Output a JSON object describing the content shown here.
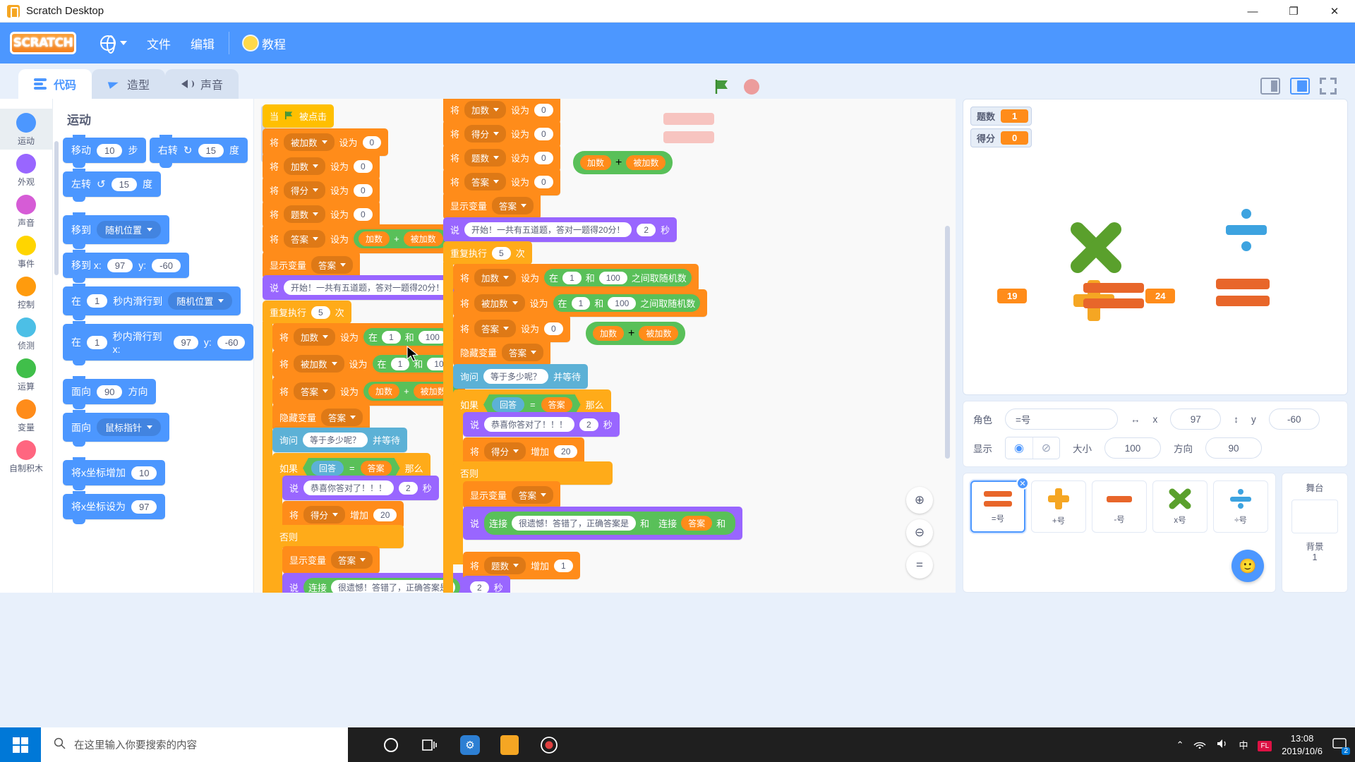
{
  "window": {
    "title": "Scratch Desktop",
    "app_icon": "scratch-app-icon",
    "minimize": "—",
    "maximize": "❐",
    "close": "✕"
  },
  "menubar": {
    "logo": "SCRATCH",
    "language_icon": "globe-icon",
    "items": [
      {
        "label": "文件",
        "name": "file"
      },
      {
        "label": "编辑",
        "name": "edit"
      },
      {
        "label": "教程",
        "name": "tutorials",
        "icon": "lightbulb-icon"
      }
    ]
  },
  "tabs": [
    {
      "label": "代码",
      "icon": "code-icon",
      "active": true
    },
    {
      "label": "造型",
      "icon": "brush-icon",
      "active": false
    },
    {
      "label": "声音",
      "icon": "sound-icon",
      "active": false
    }
  ],
  "stage_controls": {
    "green_flag": "green-flag-icon",
    "stop": "stop-icon"
  },
  "layout_controls": {
    "small_stage": "small-stage-icon",
    "large_stage": "large-stage-icon",
    "fullscreen": "fullscreen-icon"
  },
  "categories": [
    {
      "label": "运动",
      "color": "#4c97ff",
      "active": true
    },
    {
      "label": "外观",
      "color": "#9966ff",
      "active": false
    },
    {
      "label": "声音",
      "color": "#d65cd6",
      "active": false
    },
    {
      "label": "事件",
      "color": "#ffd500",
      "active": false
    },
    {
      "label": "控制",
      "color": "#ff9b0d",
      "active": false
    },
    {
      "label": "侦测",
      "color": "#4cbfe6",
      "active": false
    },
    {
      "label": "运算",
      "color": "#40bf4a",
      "active": false
    },
    {
      "label": "变量",
      "color": "#ff8c1a",
      "active": false
    },
    {
      "label": "自制积木",
      "color": "#ff6680",
      "active": false
    }
  ],
  "palette": {
    "title": "运动",
    "blocks": [
      {
        "id": "move",
        "parts": [
          "移动",
          "10",
          "步"
        ]
      },
      {
        "id": "turn-right",
        "parts": [
          "右转",
          "↻",
          "15",
          "度"
        ]
      },
      {
        "id": "turn-left",
        "parts": [
          "左转",
          "↺",
          "15",
          "度"
        ]
      },
      {
        "id": "goto",
        "parts": [
          "移到",
          "随机位置"
        ]
      },
      {
        "id": "goto-xy",
        "parts": [
          "移到 x:",
          "97",
          "y:",
          "-60"
        ]
      },
      {
        "id": "glide-to",
        "parts": [
          "在",
          "1",
          "秒内滑行到",
          "随机位置"
        ]
      },
      {
        "id": "glide-xy",
        "parts": [
          "在",
          "1",
          "秒内滑行到 x:",
          "97",
          "y:",
          "-60"
        ]
      },
      {
        "id": "point-dir",
        "parts": [
          "面向",
          "90",
          "方向"
        ]
      },
      {
        "id": "point-to",
        "parts": [
          "面向",
          "鼠标指针"
        ]
      },
      {
        "id": "change-x",
        "parts": [
          "将x坐标增加",
          "10"
        ]
      },
      {
        "id": "set-x",
        "parts": [
          "将x坐标设为",
          "97"
        ]
      }
    ],
    "labels": {
      "move": "移动",
      "steps": "步",
      "turn_right": "右转",
      "turn_left": "左转",
      "degrees": "度",
      "goto": "移到",
      "random_position": "随机位置",
      "goto_x": "移到 x:",
      "y": "y:",
      "at": "在",
      "glide_secs": "秒内滑行到",
      "glide_secs_x": "秒内滑行到 x:",
      "point_dir": "面向",
      "direction": "方向",
      "mouse_pointer": "鼠标指针",
      "change_x": "将x坐标增加",
      "set_x": "将x坐标设为"
    },
    "values": {
      "ten": "10",
      "fifteen": "15",
      "one": "1",
      "ninety": "90",
      "x97": "97",
      "yneg60": "-60"
    }
  },
  "workspace": {
    "words": {
      "when": "当",
      "clicked": "被点击",
      "set": "将",
      "to": "设为",
      "change_by": "增加",
      "show_var": "显示变量",
      "hide_var": "隐藏变量",
      "say": "说",
      "secs": "秒",
      "repeat": "重复执行",
      "times": "次",
      "pick_random_a": "在",
      "pick_random_and": "和",
      "pick_random_b": "之间取随机数",
      "ask": "询问",
      "and_wait": "并等待",
      "if": "如果",
      "then": "那么",
      "else": "否则",
      "answer": "回答",
      "equals": "=",
      "plus": "+",
      "join": "连接"
    },
    "variables": {
      "augend": "被加数",
      "addend": "加数",
      "score": "得分",
      "qcount": "题数",
      "answer_var": "答案"
    },
    "values": {
      "zero": "0",
      "one": "1",
      "hundred": "100",
      "five": "5",
      "two": "2",
      "twenty": "20"
    },
    "messages": {
      "intro": "开始！一共有五道题，答对一题得20分！",
      "question": "等于多少呢？",
      "correct": "恭喜你答对了！！！",
      "wrong": "很遗憾！答错了，正确答案是"
    },
    "zoom_controls": {
      "zoom_in": "⊕",
      "zoom_out": "⊖",
      "zoom_reset": "="
    }
  },
  "stage": {
    "monitors": [
      {
        "name": "题数",
        "value": "1"
      },
      {
        "name": "得分",
        "value": "0"
      }
    ],
    "sprites_on_stage": [
      {
        "name": "x号",
        "glyph": "×",
        "color": "#5aa02c"
      },
      {
        "name": "÷号",
        "glyph": "÷",
        "color": "#3da3e0"
      },
      {
        "name": "+号",
        "glyph": "+",
        "color": "#f5a623"
      },
      {
        "name": "=号",
        "glyph": "=",
        "color": "#e8662a"
      },
      {
        "name": "-号",
        "glyph": "-",
        "color": "#e8662a"
      }
    ],
    "number_bubbles": [
      {
        "value": "19"
      },
      {
        "value": "24"
      }
    ]
  },
  "sprite_info": {
    "sprite_label": "角色",
    "sprite_name": "=号",
    "x_label": "x",
    "x_value": "97",
    "y_label": "y",
    "y_value": "-60",
    "show_label": "显示",
    "show_on_icon": "eye-icon",
    "show_off_icon": "eye-slash-icon",
    "size_label": "大小",
    "size_value": "100",
    "direction_label": "方向",
    "direction_value": "90"
  },
  "sprite_list": [
    {
      "name": "=号",
      "glyph": "=",
      "selected": true
    },
    {
      "name": "+号",
      "glyph": "+",
      "selected": false
    },
    {
      "name": "-号",
      "glyph": "-",
      "selected": false
    },
    {
      "name": "x号",
      "glyph": "×",
      "selected": false
    },
    {
      "name": "÷号",
      "glyph": "÷",
      "selected": false
    }
  ],
  "stage_panel": {
    "title": "舞台",
    "backdrops_label": "背景",
    "backdrops_count": "1",
    "add_backdrop_icon": "add-backdrop-icon"
  },
  "add_sprite_button": {
    "icon": "add-sprite-icon"
  },
  "taskbar": {
    "start_icon": "windows-start-icon",
    "search_placeholder": "在这里输入你要搜索的内容",
    "search_icon": "search-icon",
    "apps": [
      {
        "name": "cortana-icon",
        "glyph": "○"
      },
      {
        "name": "task-view-icon",
        "glyph": "⧉"
      },
      {
        "name": "app-blue-icon",
        "glyph": "⌘"
      },
      {
        "name": "scratch-taskbar-icon",
        "glyph": "⬛"
      },
      {
        "name": "recorder-icon",
        "glyph": "◉"
      }
    ],
    "tray": {
      "chevron": "⌃",
      "network": "ᵜ",
      "volume": "🔊",
      "ime": "中",
      "flash": "FL",
      "time": "13:08",
      "date": "2019/10/6",
      "notifications": "🗪",
      "badge": "2"
    }
  }
}
